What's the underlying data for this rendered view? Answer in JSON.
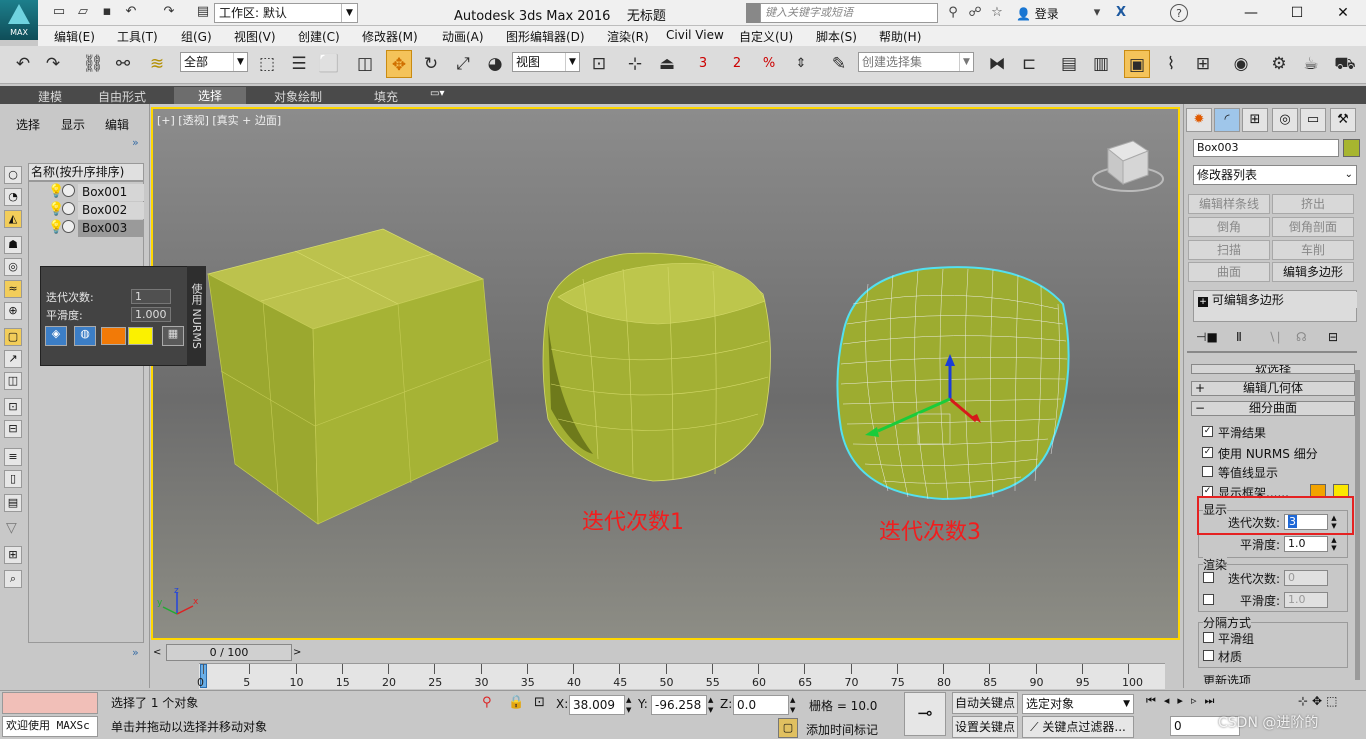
{
  "app": {
    "title": "Autodesk 3ds Max 2016",
    "doc": "无标题",
    "logo": "MAX"
  },
  "titlebar": {
    "workspace_prefix": "工作区:",
    "workspace_value": "默认",
    "search_placeholder": "键入关键字或短语",
    "login": "登录",
    "help": "?",
    "min": "—",
    "max": "☐",
    "close": "✕"
  },
  "menu": [
    "编辑(E)",
    "工具(T)",
    "组(G)",
    "视图(V)",
    "创建(C)",
    "修改器(M)",
    "动画(A)",
    "图形编辑器(D)",
    "渲染(R)",
    "Civil View",
    "自定义(U)",
    "脚本(S)",
    "帮助(H)"
  ],
  "toolbar": {
    "filter": "全部",
    "refcoord": "视图",
    "selset_placeholder": "创建选择集",
    "numbers": [
      "3",
      "2",
      "%",
      "n"
    ]
  },
  "ribbon": [
    "建模",
    "自由形式",
    "选择",
    "对象绘制",
    "填充"
  ],
  "left": {
    "tabs": [
      "选择",
      "显示",
      "编辑"
    ],
    "more": "»",
    "header": "名称(按升序排序)",
    "objects": [
      "Box001",
      "Box002",
      "Box003"
    ]
  },
  "viewport": {
    "label": "[+] [透视] [真实 + 边面]",
    "caption1": "迭代次数1",
    "caption3": "迭代次数3",
    "axes": {
      "x": "x",
      "y": "y",
      "z": "z"
    }
  },
  "nurms_panel": {
    "iter_label": "迭代次数:",
    "iter_value": "1",
    "smooth_label": "平滑度:",
    "smooth_value": "1.000",
    "tab_label": "使用 NURMS",
    "swatch1": "#f27a07",
    "swatch2": "#fbf100"
  },
  "right": {
    "object_name": "Box003",
    "object_color": "#a7b52f",
    "modifier_list": "修改器列表",
    "buttons": [
      "编辑样条线",
      "挤出",
      "倒角",
      "倒角剖面",
      "扫描",
      "车削",
      "曲面",
      "编辑多边形"
    ],
    "stack_item": "可编辑多边形",
    "rollouts": {
      "soft": "软选择",
      "edit_geom": "编辑几何体",
      "subdiv": "细分曲面"
    },
    "checks": [
      {
        "label": "平滑结果",
        "checked": true
      },
      {
        "label": "使用 NURMS 细分",
        "checked": true
      },
      {
        "label": "等值线显示",
        "checked": false
      },
      {
        "label": "显示框架......",
        "checked": true
      }
    ],
    "display": {
      "title": "显示",
      "iter_label": "迭代次数:",
      "iter_value": "3",
      "smooth_label": "平滑度:",
      "smooth_value": "1.0"
    },
    "render": {
      "title": "渲染",
      "iter_label": "迭代次数:",
      "iter_value": "0",
      "smooth_label": "平滑度:",
      "smooth_value": "1.0"
    },
    "separate": {
      "title": "分隔方式",
      "smoothing": "平滑组",
      "material": "材质"
    },
    "update": "更新选项",
    "frame_colors": [
      "#f2a300",
      "#fbe700"
    ]
  },
  "timeline": {
    "position": "0 / 100",
    "ticks": [
      "0",
      "5",
      "10",
      "15",
      "20",
      "25",
      "30",
      "35",
      "40",
      "45",
      "50",
      "55",
      "60",
      "65",
      "70",
      "75",
      "80",
      "85",
      "90",
      "95",
      "100"
    ]
  },
  "status": {
    "maxscript": "欢迎使用 MAXSc",
    "selected": "选择了 1 个对象",
    "prompt": "单击并拖动以选择并移动对象",
    "x_label": "X:",
    "x": "38.009",
    "y_label": "Y:",
    "y": "-96.258",
    "z_label": "Z:",
    "z": "0.0",
    "grid": "栅格 = 10.0",
    "autokey": "自动关键点",
    "setkey": "设置关键点",
    "keymode": "选定对象",
    "keyfilter": "关键点过滤器...",
    "addtime": "添加时间标记",
    "frame": "0",
    "watermark": "CSDN @进阶的"
  }
}
